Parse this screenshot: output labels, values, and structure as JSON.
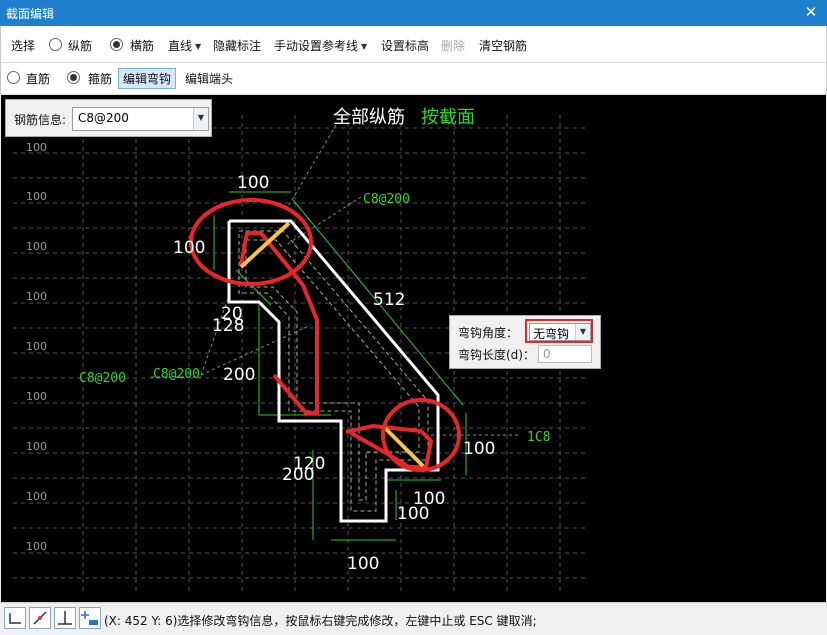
{
  "window": {
    "title": "截面编辑",
    "close_glyph": "✕"
  },
  "toolbar1": {
    "select": "选择",
    "longitudinal": "纵筋",
    "stirrup_bar": "横筋",
    "straight_line": "直线",
    "hide_dimension": "隐藏标注",
    "manual_ref_line": "手动设置参考线",
    "set_elevation": "设置标高",
    "delete": "删除",
    "clear_rebar": "清空钢筋"
  },
  "toolbar2": {
    "straight_bar": "直筋",
    "hoop_bar": "箍筋",
    "edit_hook": "编辑弯钩",
    "edit_end": "编辑端头"
  },
  "rebar_info": {
    "label": "钢筋信息:",
    "value": "C8@200"
  },
  "hook_panel": {
    "angle_label": "弯钩角度：",
    "angle_value": "无弯钩",
    "length_label": "弯钩长度(d)：",
    "length_value": "0"
  },
  "canvas": {
    "heading_white": "全部纵筋",
    "heading_green": "按截面",
    "grid_label": "100",
    "dims": [
      "100",
      "100",
      "512",
      "20",
      "128",
      "200",
      "100",
      "120",
      "200",
      "100",
      "100",
      "100"
    ],
    "rebar_labels": [
      "C8@200",
      "C8@200",
      "C8@200",
      "1C8"
    ]
  },
  "status": {
    "text": "(X: 452 Y: 6)选择修改弯钩信息，按鼠标右键完成修改，左键中止或 ESC 键取消;"
  },
  "colors": {
    "titlebar": "#1e7fcf",
    "canvas_bg": "#000000",
    "green": "#22dd22",
    "red": "#e8262a",
    "yellow": "#f5c24a"
  },
  "icons": [
    "close-icon",
    "dropdown-caret-icon",
    "snap-orthogonal-icon",
    "snap-angle-icon",
    "snap-perpendicular-icon",
    "add-point-icon"
  ]
}
